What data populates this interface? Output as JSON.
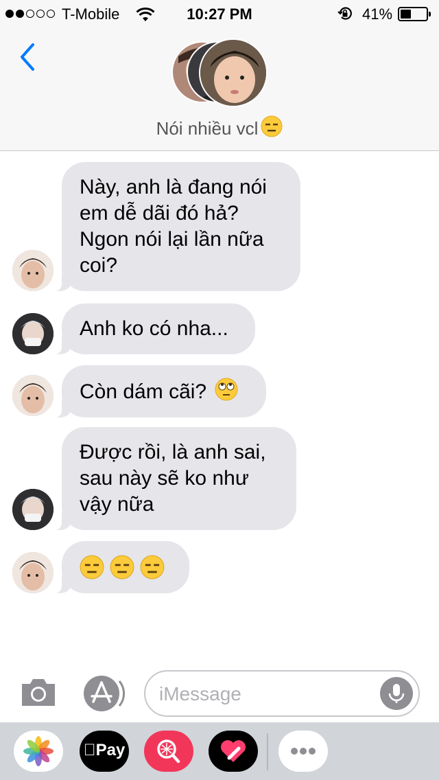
{
  "status_bar": {
    "carrier": "T-Mobile",
    "time": "10:27 PM",
    "battery_percent": "41%",
    "battery_level": 0.41,
    "signal_strength_of_5": 2
  },
  "header": {
    "group_name": "Nói nhiều vcl",
    "back_icon": "chevron-left-icon"
  },
  "messages": [
    {
      "sender": "a",
      "text": [
        "Này, anh là đang nói",
        "em dễ dãi đó hả?",
        "Ngon nói lại lần nữa",
        "coi?"
      ]
    },
    {
      "sender": "b",
      "text": [
        "Anh ko có nha..."
      ]
    },
    {
      "sender": "a",
      "text": [
        "Còn dám cãi?"
      ],
      "emoji": "face-with-rolling-eyes"
    },
    {
      "sender": "b",
      "text": [
        "Được rồi, là anh sai,",
        "sau này sẽ ko như",
        "vậy nữa"
      ]
    },
    {
      "sender": "a",
      "text": [],
      "emoji": "expressionless-face x3"
    }
  ],
  "input": {
    "placeholder": "iMessage"
  },
  "app_drawer": {
    "apps": [
      "photos-icon",
      "apple-pay-icon",
      "images-search-icon",
      "digital-touch-icon",
      "more-apps-icon"
    ],
    "apple_pay_label": "Pay"
  },
  "colors": {
    "accent": "#007aff",
    "bubble_gray": "#e5e5ea",
    "header_bg": "#f7f7f7",
    "drawer_bg": "#d1d4d9"
  }
}
